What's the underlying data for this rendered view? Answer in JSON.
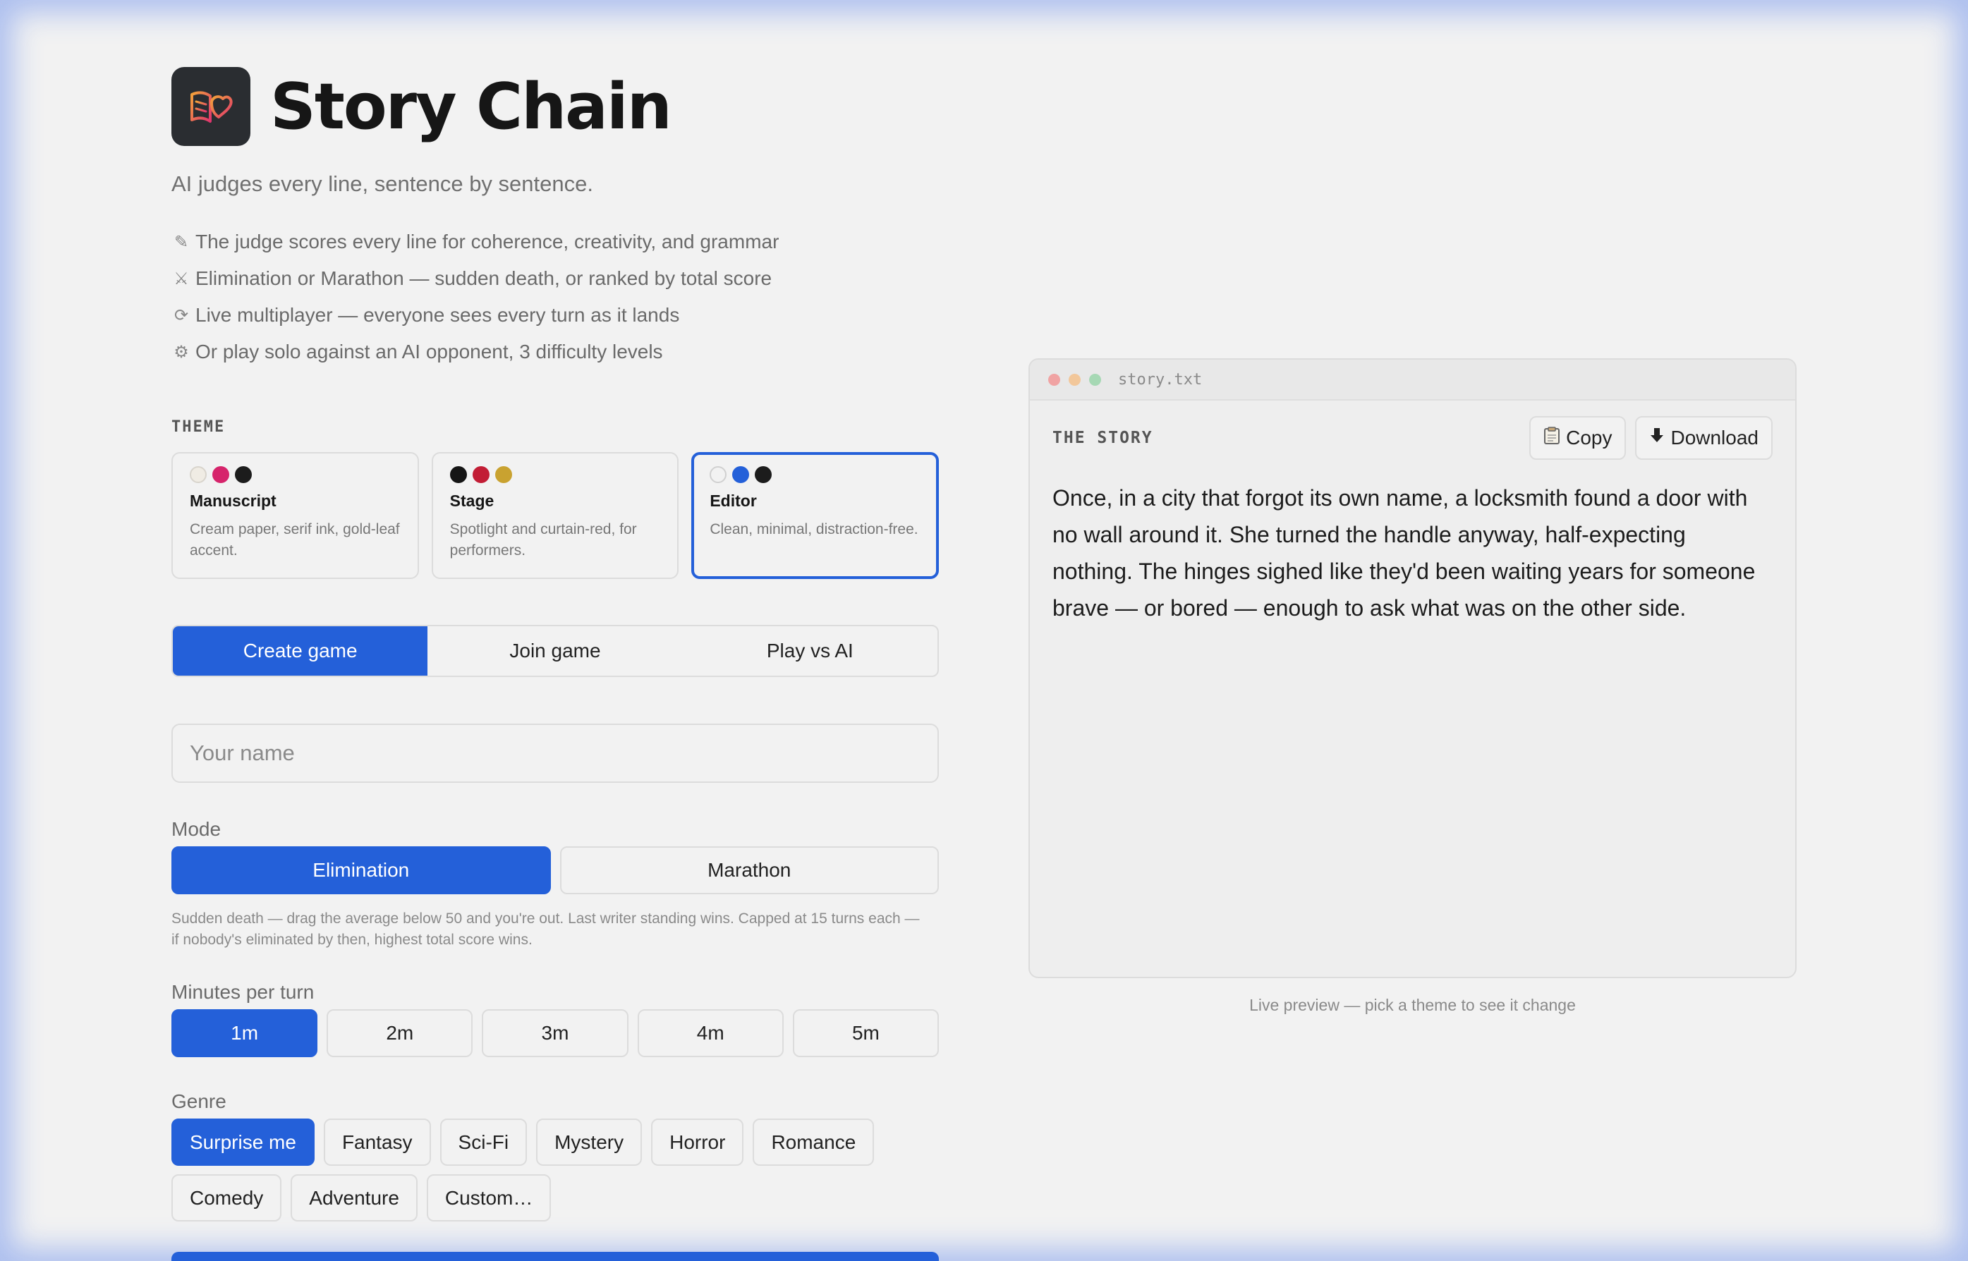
{
  "app": {
    "title": "Story Chain",
    "tagline": "AI judges every line, sentence by sentence."
  },
  "features": [
    {
      "icon": "pen-icon",
      "glyph": "✎",
      "text": "The judge scores every line for coherence, creativity, and grammar"
    },
    {
      "icon": "crossed-swords-icon",
      "glyph": "⚔",
      "text": "Elimination or Marathon — sudden death, or ranked by total score"
    },
    {
      "icon": "refresh-icon",
      "glyph": "⟳",
      "text": "Live multiplayer — everyone sees every turn as it lands"
    },
    {
      "icon": "robot-icon",
      "glyph": "⚙",
      "text": "Or play solo against an AI opponent, 3 difficulty levels"
    }
  ],
  "theme": {
    "label": "THEME",
    "cards": [
      {
        "name": "Manuscript",
        "desc": "Cream paper, serif ink, gold-leaf accent.",
        "colors": [
          "#f0ece4",
          "#d6246b",
          "#1c1c1c"
        ],
        "selected": false
      },
      {
        "name": "Stage",
        "desc": "Spotlight and curtain-red, for performers.",
        "colors": [
          "#151515",
          "#c21d35",
          "#c9a230"
        ],
        "selected": false
      },
      {
        "name": "Editor",
        "desc": "Clean, minimal, distraction-free.",
        "colors": [
          "#f2f2f2",
          "#2460d9",
          "#1c1c1c"
        ],
        "selected": true
      }
    ]
  },
  "tabs": [
    {
      "label": "Create game",
      "active": true
    },
    {
      "label": "Join game",
      "active": false
    },
    {
      "label": "Play vs AI",
      "active": false
    }
  ],
  "name_input": {
    "placeholder": "Your name",
    "value": ""
  },
  "mode": {
    "label": "Mode",
    "options": [
      {
        "label": "Elimination",
        "active": true
      },
      {
        "label": "Marathon",
        "active": false
      }
    ],
    "help": "Sudden death — drag the average below 50 and you're out. Last writer standing wins. Capped at 15 turns each — if nobody's eliminated by then, highest total score wins."
  },
  "minutes": {
    "label": "Minutes per turn",
    "options": [
      {
        "label": "1m",
        "active": true
      },
      {
        "label": "2m",
        "active": false
      },
      {
        "label": "3m",
        "active": false
      },
      {
        "label": "4m",
        "active": false
      },
      {
        "label": "5m",
        "active": false
      }
    ]
  },
  "genre": {
    "label": "Genre",
    "options": [
      {
        "label": "Surprise me",
        "active": true
      },
      {
        "label": "Fantasy",
        "active": false
      },
      {
        "label": "Sci-Fi",
        "active": false
      },
      {
        "label": "Mystery",
        "active": false
      },
      {
        "label": "Horror",
        "active": false
      },
      {
        "label": "Romance",
        "active": false
      },
      {
        "label": "Comedy",
        "active": false
      },
      {
        "label": "Adventure",
        "active": false
      },
      {
        "label": "Custom…",
        "active": false
      }
    ]
  },
  "preview": {
    "filename": "story.txt",
    "story_label": "THE STORY",
    "copy_label": "Copy",
    "download_label": "Download",
    "story_text": "Once, in a city that forgot its own name, a locksmith found a door with no wall around it. She turned the handle anyway, half-expecting nothing. The hinges sighed like they'd been waiting years for someone brave — or bored — enough to ask what was on the other side.",
    "caption": "Live preview — pick a theme to see it change",
    "window_dots": [
      "#f0a3a3",
      "#f2c79a",
      "#a6d8b4"
    ]
  },
  "colors": {
    "accent": "#2460d9",
    "background": "#f2f2f2",
    "border": "#dcdcdc"
  }
}
